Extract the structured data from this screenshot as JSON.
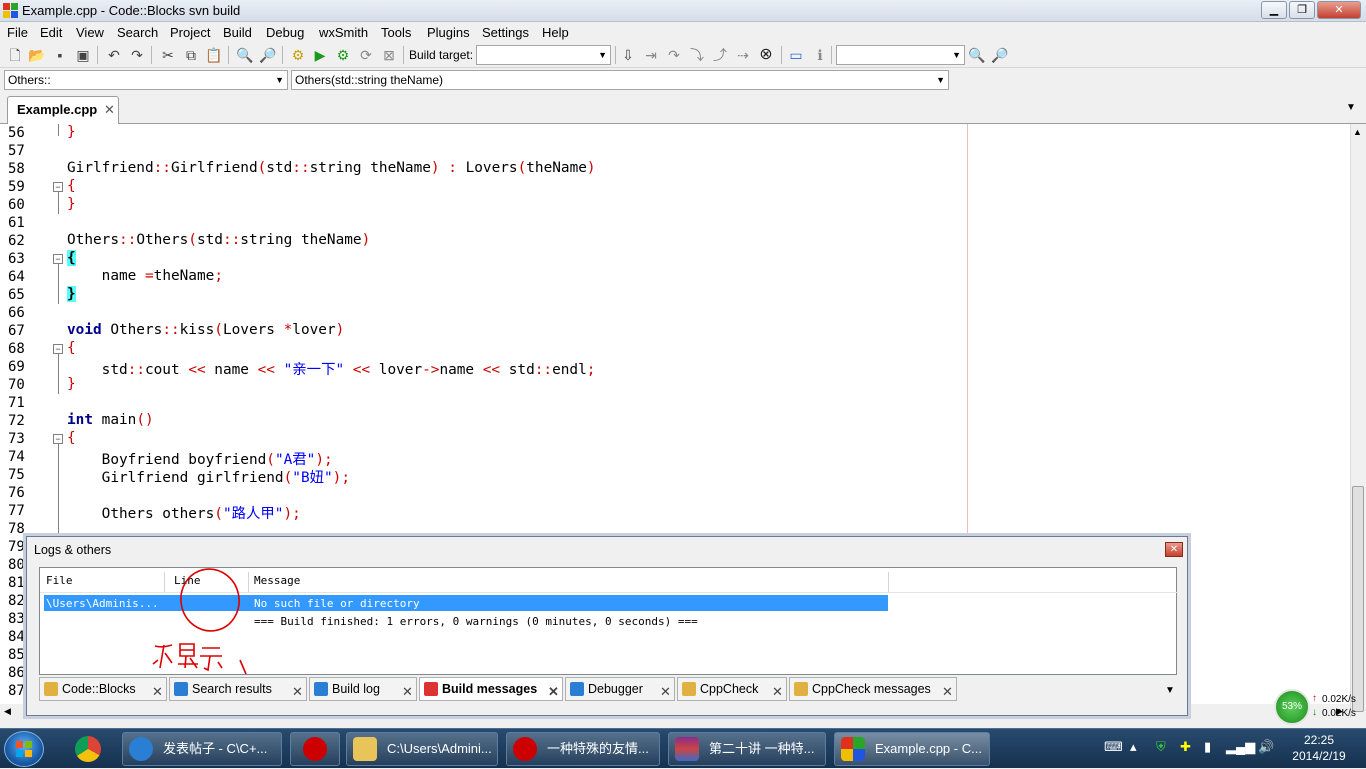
{
  "window": {
    "title": "Example.cpp - Code::Blocks svn build"
  },
  "menu": [
    "File",
    "Edit",
    "View",
    "Search",
    "Project",
    "Build",
    "Debug",
    "wxSmith",
    "Tools",
    "Plugins",
    "Settings",
    "Help"
  ],
  "toolbar": {
    "build_target_label": "Build target:",
    "build_target_value": "",
    "search_value": ""
  },
  "scope": {
    "class_combo": "Others::",
    "func_combo": "Others(std::string theName)"
  },
  "editor": {
    "tab_label": "Example.cpp",
    "lines": [
      {
        "n": "56",
        "t": "}"
      },
      {
        "n": "57",
        "t": ""
      },
      {
        "n": "58",
        "t": "Girlfriend::Girlfriend(std::string theName) : Lovers(theName)"
      },
      {
        "n": "59",
        "t": "{"
      },
      {
        "n": "60",
        "t": "}"
      },
      {
        "n": "61",
        "t": ""
      },
      {
        "n": "62",
        "t": "Others::Others(std::string theName)"
      },
      {
        "n": "63",
        "t": "{"
      },
      {
        "n": "64",
        "t": "    name =theName;"
      },
      {
        "n": "65",
        "t": "}"
      },
      {
        "n": "66",
        "t": ""
      },
      {
        "n": "67",
        "t": "void Others::kiss(Lovers *lover)"
      },
      {
        "n": "68",
        "t": "{"
      },
      {
        "n": "69",
        "t": "    std::cout << name << \"亲一下\" << lover->name << std::endl;"
      },
      {
        "n": "70",
        "t": "}"
      },
      {
        "n": "71",
        "t": ""
      },
      {
        "n": "72",
        "t": "int main()"
      },
      {
        "n": "73",
        "t": "{"
      },
      {
        "n": "74",
        "t": "    Boyfriend boyfriend(\"A君\");"
      },
      {
        "n": "75",
        "t": "    Girlfriend girlfriend(\"B妞\");"
      },
      {
        "n": "76",
        "t": ""
      },
      {
        "n": "77",
        "t": "    Others others(\"路人甲\");"
      },
      {
        "n": "78",
        "t": ""
      },
      {
        "n": "79",
        "t": ""
      },
      {
        "n": "80",
        "t": ""
      },
      {
        "n": "81",
        "t": ""
      },
      {
        "n": "82",
        "t": ""
      },
      {
        "n": "83",
        "t": ""
      },
      {
        "n": "84",
        "t": ""
      },
      {
        "n": "85",
        "t": ""
      },
      {
        "n": "86",
        "t": ""
      },
      {
        "n": "87",
        "t": ""
      }
    ]
  },
  "logs": {
    "title": "Logs & others",
    "columns": [
      "File",
      "Line",
      "Message"
    ],
    "rows": [
      {
        "file": "\\Users\\Adminis...",
        "line": "",
        "message": "No such file or directory"
      },
      {
        "file": "",
        "line": "",
        "message": "=== Build finished: 1 errors, 0 warnings (0 minutes, 0 seconds) ==="
      }
    ],
    "annotation": "不显示",
    "tabs": [
      "Code::Blocks",
      "Search results",
      "Build log",
      "Build messages",
      "Debugger",
      "CppCheck",
      "CppCheck messages"
    ]
  },
  "network": {
    "percent": "53%",
    "up": "0.02K/s",
    "down": "0.02K/s"
  },
  "taskbar": {
    "items": [
      "发表帖子 - C\\C+...",
      "C:\\Users\\Admini...",
      "一种特殊的友情...",
      "第二十讲 一种特...",
      "Example.cpp - C..."
    ],
    "time": "22:25",
    "date": "2014/2/19"
  },
  "colors": {
    "keyword": "#00008b",
    "punct": "#cc0000",
    "string": "#0000ff",
    "selection": "#3399ff",
    "brace_highlight": "#55ffff"
  }
}
